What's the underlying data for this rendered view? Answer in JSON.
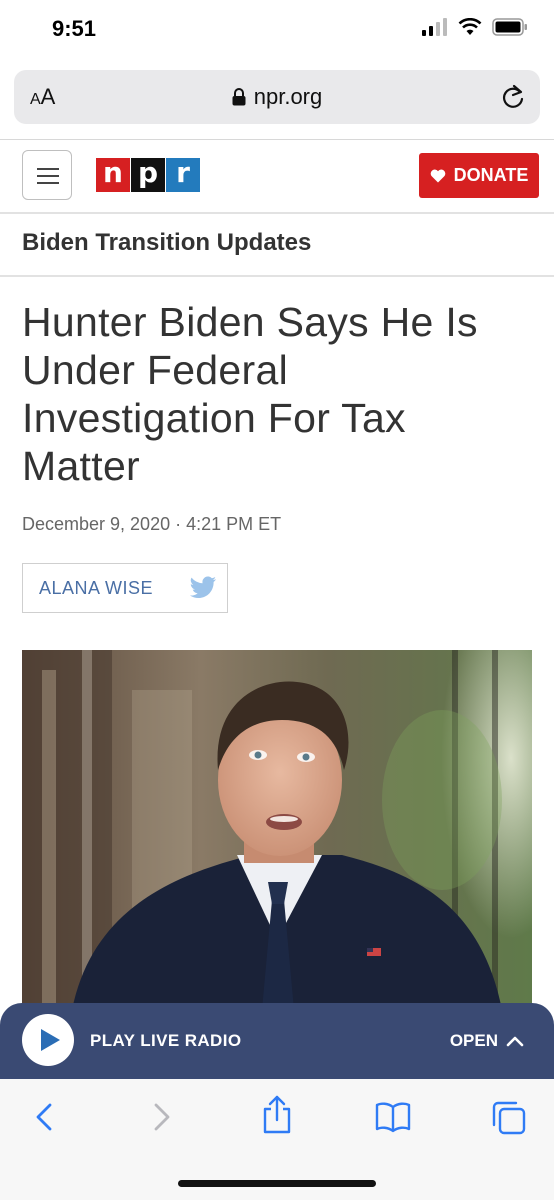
{
  "status": {
    "time": "9:51"
  },
  "browser": {
    "text_size_label": "AA",
    "url": "npr.org"
  },
  "header": {
    "logo_letters": [
      "n",
      "p",
      "r"
    ],
    "logo_colors": [
      "#d62021",
      "#111111",
      "#237bbd"
    ],
    "donate_label": "DONATE"
  },
  "section": {
    "title": "Biden Transition Updates"
  },
  "article": {
    "headline": "Hunter Biden Says He Is Under Federal Investigation For Tax Matter",
    "date": "December 9, 2020",
    "time": "4:21 PM ET",
    "author": "ALANA WISE"
  },
  "radio": {
    "play_label": "PLAY LIVE RADIO",
    "open_label": "OPEN"
  },
  "colors": {
    "accent_red": "#d62021",
    "radio_bar": "#3a4a73",
    "link_blue": "#4a6fa5"
  }
}
